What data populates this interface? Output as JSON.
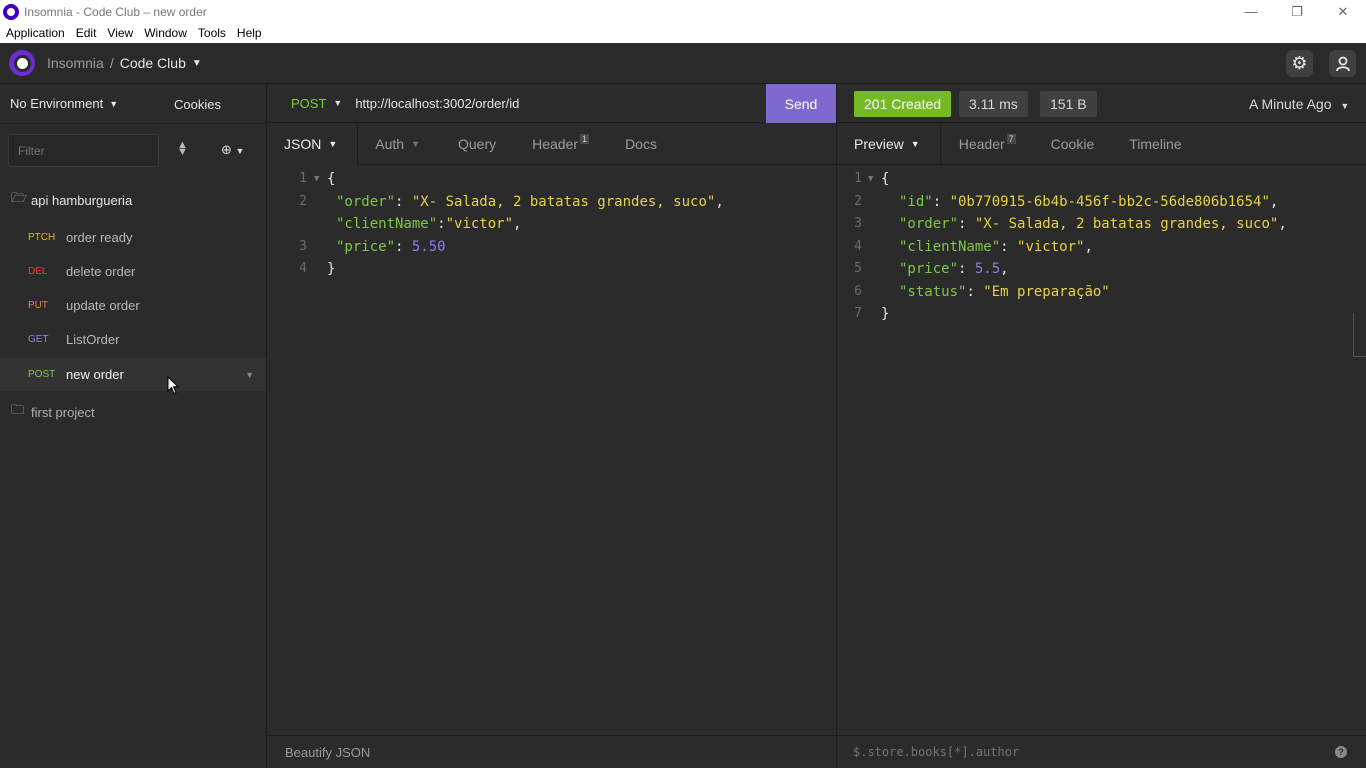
{
  "window": {
    "title": "Insomnia - Code Club – new order"
  },
  "menu": [
    "Application",
    "Edit",
    "View",
    "Window",
    "Tools",
    "Help"
  ],
  "header": {
    "workspace_parent": "Insomnia",
    "separator": "/",
    "workspace": "Code Club"
  },
  "sidebar": {
    "environment": "No Environment",
    "cookies": "Cookies",
    "filter_placeholder": "Filter",
    "folders": [
      {
        "name": "api hamburgueria",
        "expanded": true
      },
      {
        "name": "first project",
        "expanded": false
      }
    ],
    "requests": [
      {
        "method": "PTCH",
        "name": "order ready",
        "color": "#e6b800"
      },
      {
        "method": "DEL",
        "name": "delete order",
        "color": "#e8413c"
      },
      {
        "method": "PUT",
        "name": "update order",
        "color": "#e88a1a"
      },
      {
        "method": "GET",
        "name": "ListOrder",
        "color": "#8a8ae6"
      },
      {
        "method": "POST",
        "name": "new order",
        "color": "#7dcc3e",
        "active": true
      }
    ]
  },
  "request": {
    "method": "POST",
    "url": "http://localhost:3002/order/id",
    "send_label": "Send",
    "tabs": {
      "body": "JSON",
      "auth": "Auth",
      "query": "Query",
      "header": "Header",
      "header_count": "1",
      "docs": "Docs"
    },
    "footer": "Beautify JSON",
    "body_lines": {
      "l1": "{",
      "l2_key": "\"order\"",
      "l2_val": "\"X- Salada, 2 batatas grandes, suco\"",
      "l2b_key": "\"clientName\"",
      "l2b_val": "\"victor\"",
      "l3_key": "\"price\"",
      "l3_val": "5.50",
      "l4": "}"
    }
  },
  "response": {
    "status": "201 Created",
    "time": "3.11 ms",
    "size": "151 B",
    "when": "A Minute Ago",
    "status_color": "#75ba24",
    "tabs": {
      "preview": "Preview",
      "header": "Header",
      "header_count": "7",
      "cookie": "Cookie",
      "timeline": "Timeline"
    },
    "filter_placeholder": "$.store.books[*].author",
    "body_lines": {
      "l1": "{",
      "id_key": "\"id\"",
      "id_val": "\"0b770915-6b4b-456f-bb2c-56de806b1654\"",
      "order_key": "\"order\"",
      "order_val": "\"X- Salada, 2 batatas grandes, suco\"",
      "client_key": "\"clientName\"",
      "client_val": "\"victor\"",
      "price_key": "\"price\"",
      "price_val": "5.5",
      "status_key": "\"status\"",
      "status_val": "\"Em preparação\"",
      "l7": "}"
    }
  }
}
